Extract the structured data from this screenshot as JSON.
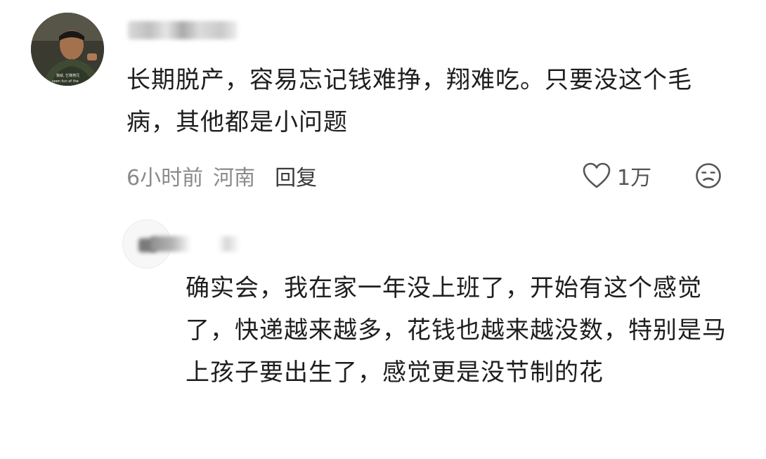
{
  "comment": {
    "author": {
      "avatar_icon": "user-photo-avatar-icon",
      "name_redacted": true
    },
    "text": "长期脱产，容易忘记钱难挣，翔难吃。只要没这个毛病，其他都是小问题",
    "time": "6小时前",
    "location": "河南",
    "reply_label": "回复",
    "like_icon": "heart-outline-icon",
    "like_count": "1万",
    "dislike_icon": "meh-face-icon"
  },
  "reply": {
    "author": {
      "avatar_icon": "user-avatar-icon",
      "name_redacted": true
    },
    "text": "确实会，我在家一年没上班了，开始有这个感觉了，快递越来越多，花钱也越来越没数，特别是马上孩子要出生了，感觉更是没节制的花"
  },
  "colors": {
    "text_primary": "#1e1e1e",
    "text_meta": "#8a8a8a",
    "icon_stroke": "#555555",
    "background": "#ffffff"
  }
}
